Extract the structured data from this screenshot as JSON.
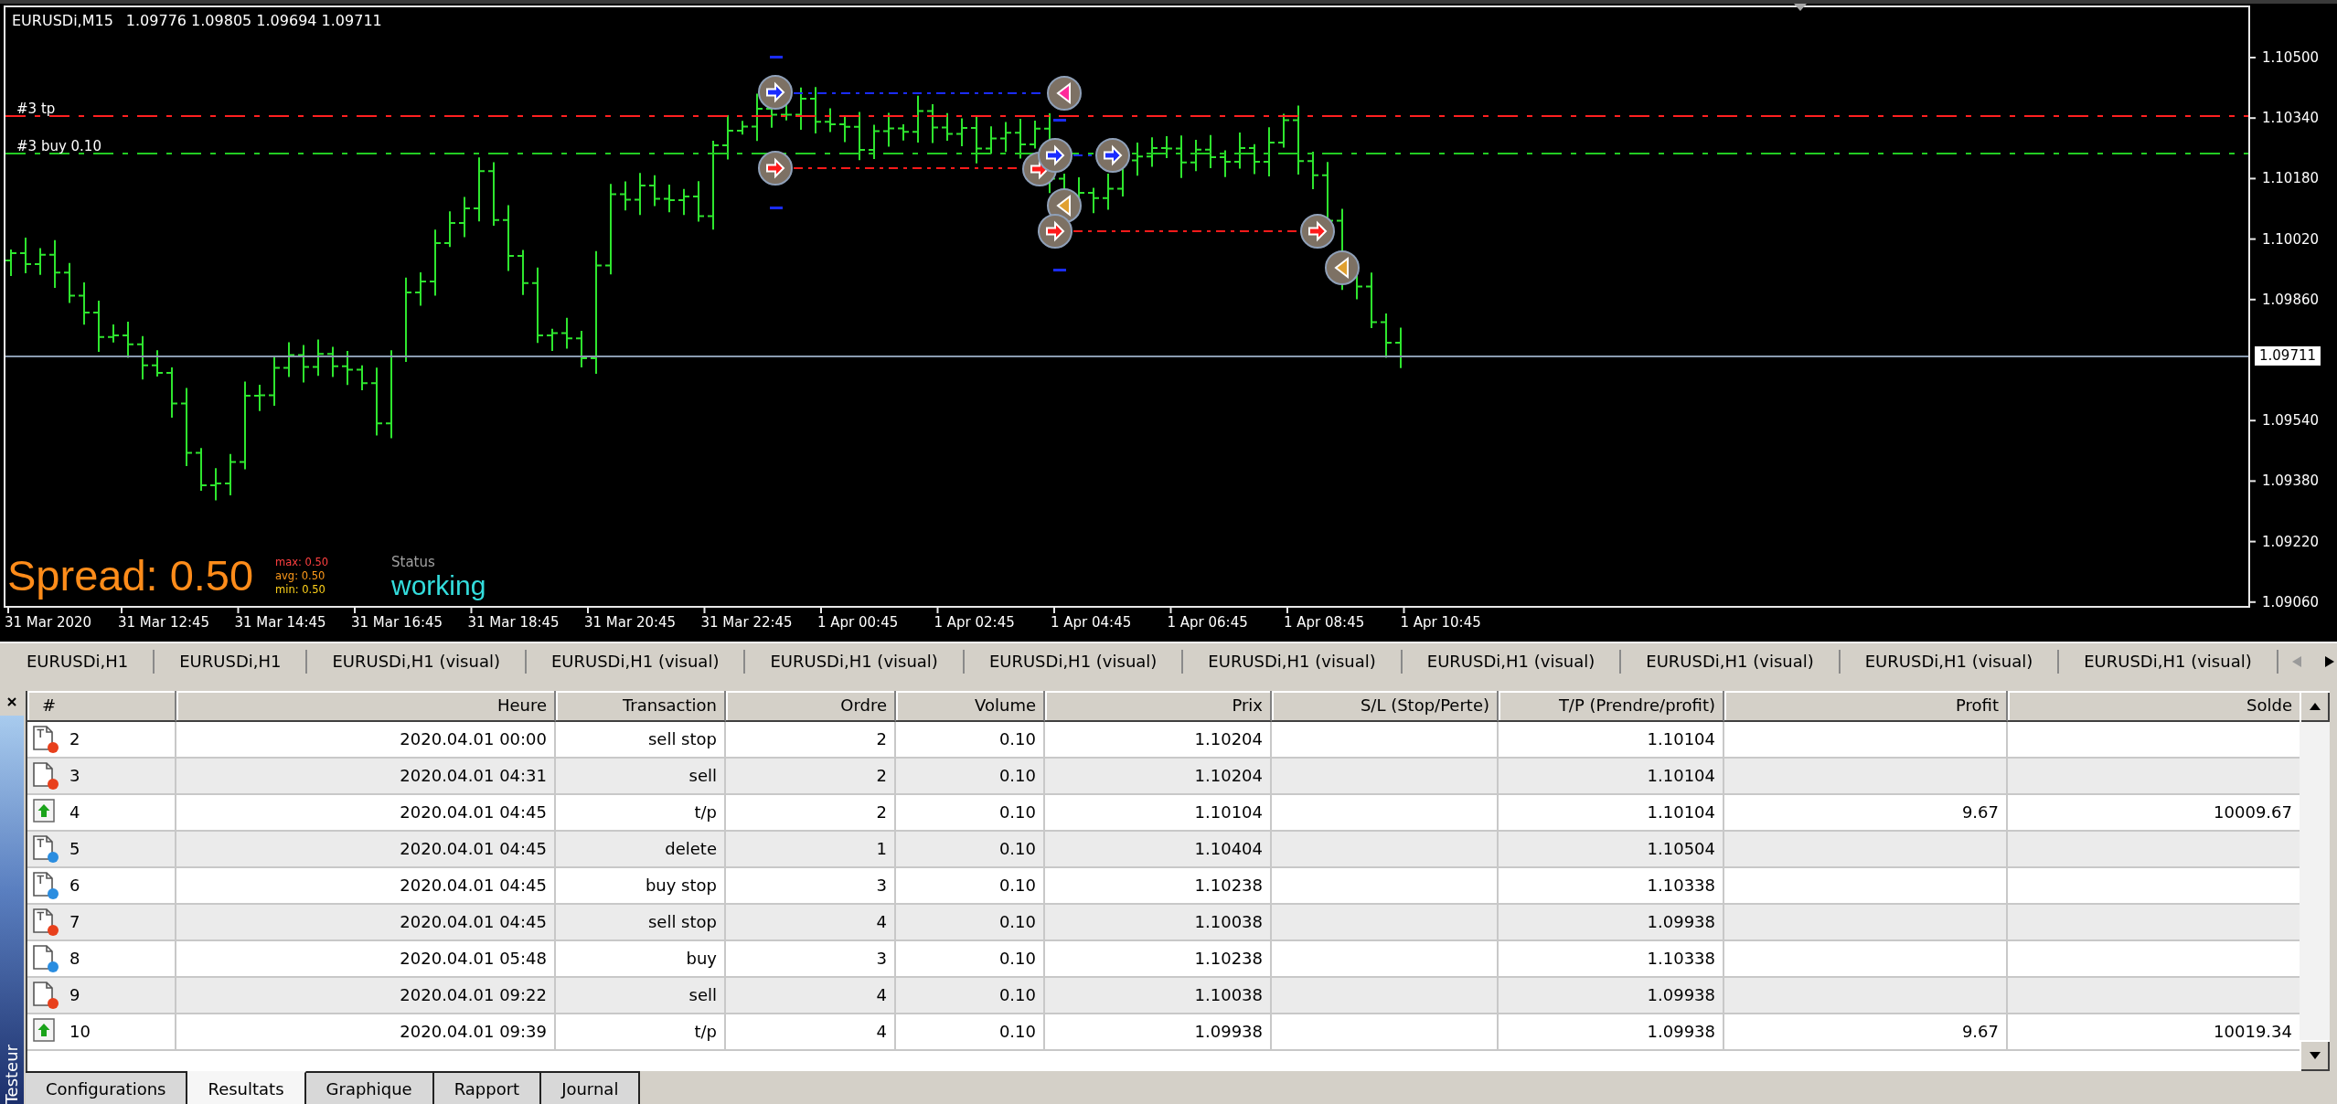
{
  "chart": {
    "symbol": "EURUSDi,M15",
    "quote": "1.09776 1.09805 1.09694 1.09711",
    "level_lines": [
      {
        "label": "#3 tp",
        "color": "#ff2020"
      },
      {
        "label": "#3 buy 0.10",
        "color": "#22cc22"
      }
    ],
    "price_ticks": [
      "1.10500",
      "1.10340",
      "1.10180",
      "1.10020",
      "1.09860",
      "1.09540",
      "1.09380",
      "1.09220",
      "1.09060"
    ],
    "current_price": "1.09711",
    "time_ticks": [
      "31 Mar 2020",
      "31 Mar 12:45",
      "31 Mar 14:45",
      "31 Mar 16:45",
      "31 Mar 18:45",
      "31 Mar 20:45",
      "31 Mar 22:45",
      "1 Apr 00:45",
      "1 Apr 02:45",
      "1 Apr 04:45",
      "1 Apr 06:45",
      "1 Apr 08:45",
      "1 Apr 10:45"
    ],
    "spread": {
      "value": "Spread: 0.50",
      "stats": [
        {
          "text": "max: 0.50",
          "color": "#ff4040"
        },
        {
          "text": "avg: 0.50",
          "color": "#ff9a1a"
        },
        {
          "text": "min: 0.50",
          "color": "#ffd21a"
        }
      ]
    },
    "status": {
      "label": "Status",
      "value": "working"
    }
  },
  "chart_tabs": [
    {
      "label": "EURUSDi,H1",
      "selected": false
    },
    {
      "label": "EURUSDi,H1",
      "selected": false
    },
    {
      "label": "EURUSDi,H1 (visual)",
      "selected": false
    },
    {
      "label": "EURUSDi,H1 (visual)",
      "selected": false
    },
    {
      "label": "EURUSDi,H1 (visual)",
      "selected": false
    },
    {
      "label": "EURUSDi,H1 (visual)",
      "selected": false
    },
    {
      "label": "EURUSDi,H1 (visual)",
      "selected": false
    },
    {
      "label": "EURUSDi,H1 (visual)",
      "selected": false
    },
    {
      "label": "EURUSDi,H1 (visual)",
      "selected": false
    },
    {
      "label": "EURUSDi,H1 (visual)",
      "selected": false
    },
    {
      "label": "EURUSDi,H1 (visual)",
      "selected": false
    }
  ],
  "tab_scroll": [
    {
      "kind": "left",
      "disabled": true
    },
    {
      "kind": "right",
      "disabled": false
    }
  ],
  "side_panel": {
    "title": "Testeur"
  },
  "results": {
    "columns": [
      "#",
      "Heure",
      "Transaction",
      "Ordre",
      "Volume",
      "Prix",
      "S/L (Stop/Perte)",
      "T/P (Prendre/profit)",
      "Profit",
      "Solde"
    ],
    "rows": [
      {
        "kind": "pending",
        "color": "#e8401c",
        "number": "2",
        "time": "2020.04.01 00:00",
        "transaction": "sell stop",
        "order": "2",
        "volume": "0.10",
        "price": "1.10204",
        "tp": "1.10104"
      },
      {
        "kind": "market",
        "color": "#e8401c",
        "number": "3",
        "time": "2020.04.01 04:31",
        "transaction": "sell",
        "order": "2",
        "volume": "0.10",
        "price": "1.10204",
        "tp": "1.10104"
      },
      {
        "kind": "take_profit",
        "number": "4",
        "time": "2020.04.01 04:45",
        "transaction": "t/p",
        "order": "2",
        "volume": "0.10",
        "price": "1.10104",
        "tp": "1.10104",
        "profit": "9.67",
        "balance": "10009.67"
      },
      {
        "kind": "pending",
        "color": "#2a8de0",
        "number": "5",
        "time": "2020.04.01 04:45",
        "transaction": "delete",
        "order": "1",
        "volume": "0.10",
        "price": "1.10404",
        "tp": "1.10504"
      },
      {
        "kind": "pending",
        "color": "#2a8de0",
        "number": "6",
        "time": "2020.04.01 04:45",
        "transaction": "buy stop",
        "order": "3",
        "volume": "0.10",
        "price": "1.10238",
        "tp": "1.10338"
      },
      {
        "kind": "pending",
        "color": "#e8401c",
        "number": "7",
        "time": "2020.04.01 04:45",
        "transaction": "sell stop",
        "order": "4",
        "volume": "0.10",
        "price": "1.10038",
        "tp": "1.09938"
      },
      {
        "kind": "market",
        "color": "#2a8de0",
        "number": "8",
        "time": "2020.04.01 05:48",
        "transaction": "buy",
        "order": "3",
        "volume": "0.10",
        "price": "1.10238",
        "tp": "1.10338"
      },
      {
        "kind": "market",
        "color": "#e8401c",
        "number": "9",
        "time": "2020.04.01 09:22",
        "transaction": "sell",
        "order": "4",
        "volume": "0.10",
        "price": "1.10038",
        "tp": "1.09938"
      },
      {
        "kind": "take_profit",
        "number": "10",
        "time": "2020.04.01 09:39",
        "transaction": "t/p",
        "order": "4",
        "volume": "0.10",
        "price": "1.09938",
        "tp": "1.09938",
        "profit": "9.67",
        "balance": "10019.34"
      }
    ]
  },
  "bottom_tabs": [
    {
      "label": "Configurations",
      "selected": false
    },
    {
      "label": "Resultats",
      "selected": true
    },
    {
      "label": "Graphique",
      "selected": false
    },
    {
      "label": "Rapport",
      "selected": false
    },
    {
      "label": "Journal",
      "selected": false
    }
  ]
}
